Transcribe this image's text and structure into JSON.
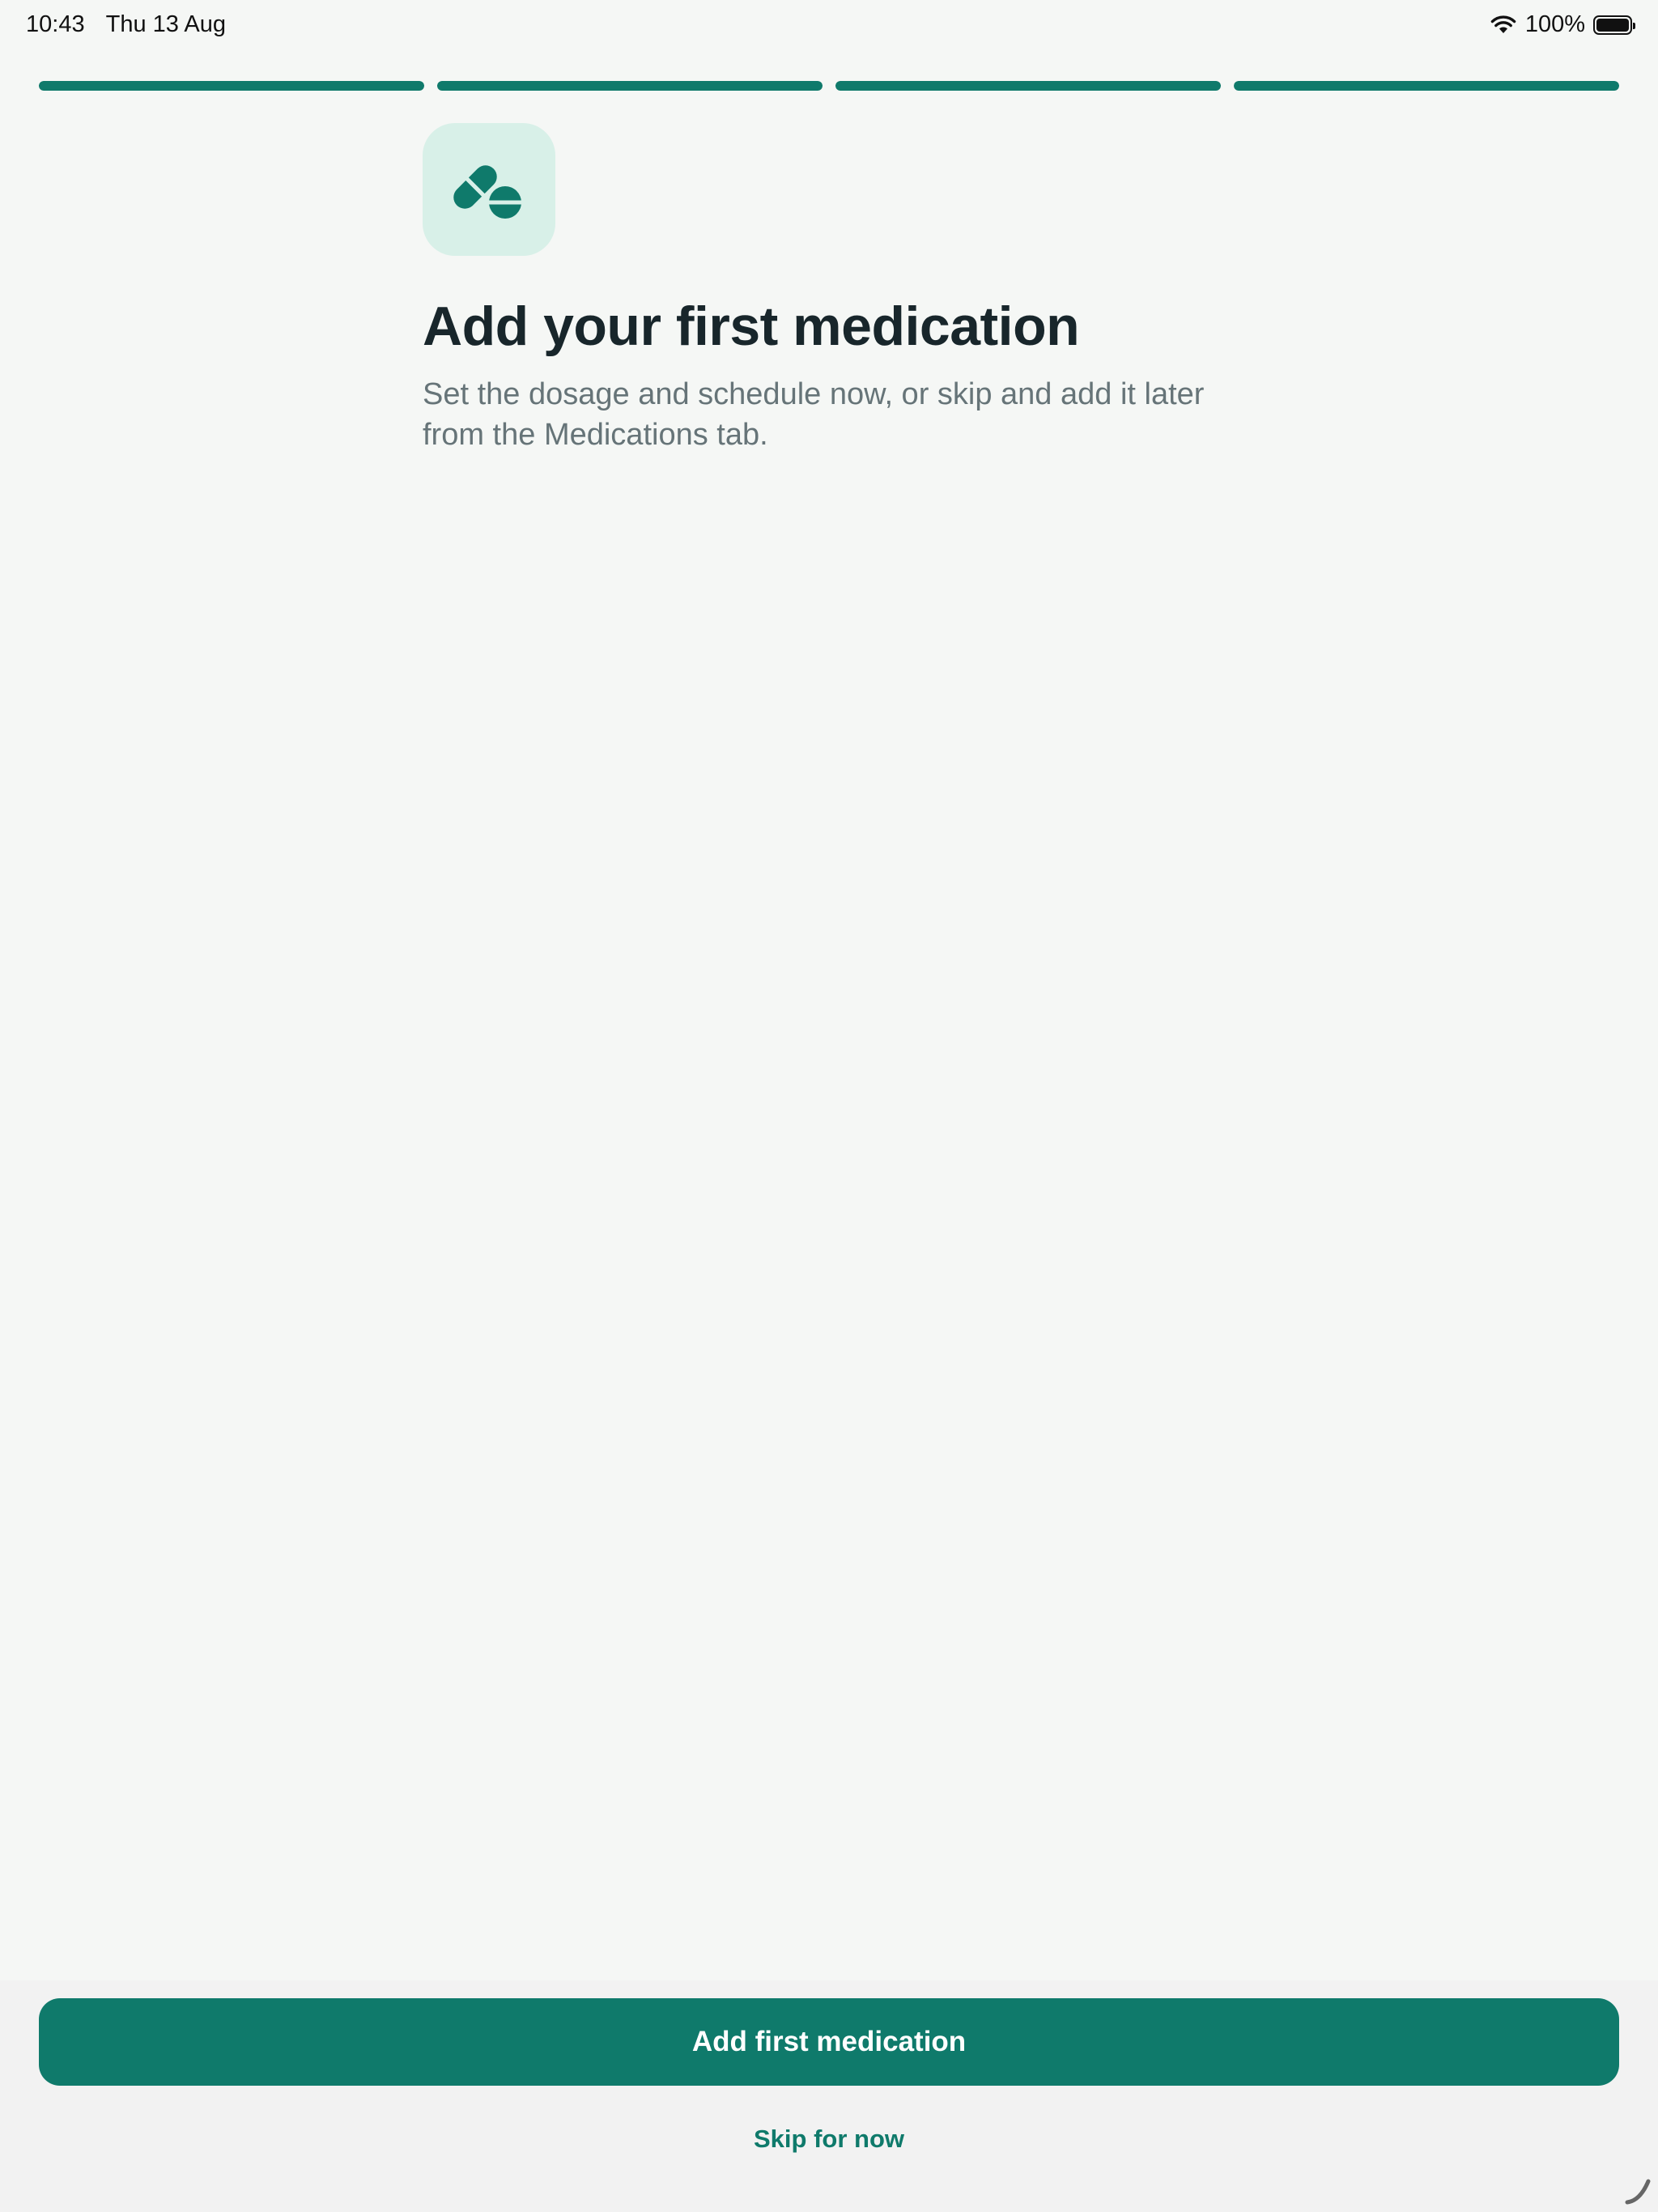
{
  "status_bar": {
    "time": "10:43",
    "date": "Thu 13 Aug",
    "battery": "100%",
    "wifi_icon": "wifi-icon",
    "battery_icon": "battery-icon"
  },
  "onboarding": {
    "steps_total": 4,
    "steps_completed": 4,
    "step_fill_fraction": [
      1,
      1,
      1,
      1
    ],
    "icon": "pills-icon",
    "title": "Add your first medication",
    "subtitle": "Set the dosage and schedule now, or skip and add it later from the Medications tab."
  },
  "actions": {
    "primary_label": "Add first medication",
    "secondary_label": "Skip for now"
  },
  "colors": {
    "accent": "#0f7a6b",
    "icon_tile_bg": "#d8f0e8",
    "page_bg": "#f5f7f5",
    "bottom_panel_bg": "#f2f2f2",
    "title_text": "#18262b",
    "subtitle_text": "#667478"
  }
}
